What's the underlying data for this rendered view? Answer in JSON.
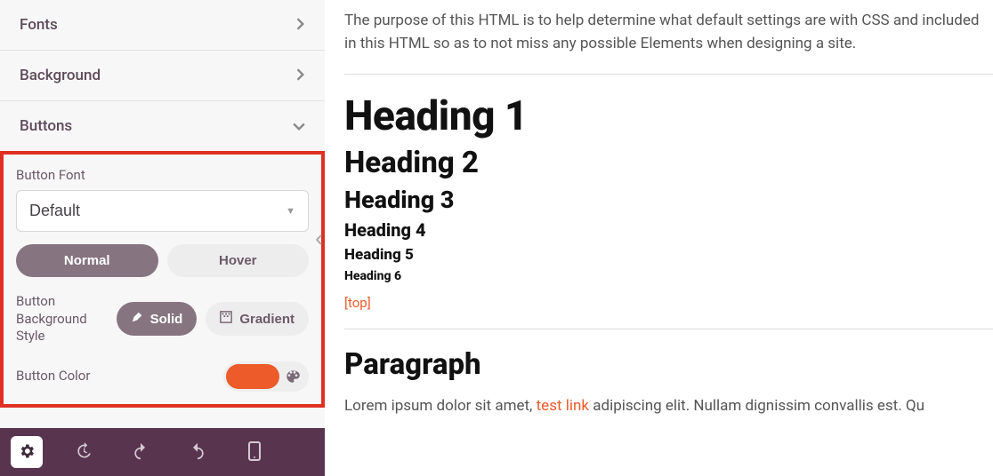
{
  "sidebar": {
    "sections": {
      "fonts": "Fonts",
      "background": "Background",
      "buttons": "Buttons"
    },
    "buttonFont": {
      "label": "Button Font",
      "value": "Default"
    },
    "stateTabs": {
      "normal": "Normal",
      "hover": "Hover"
    },
    "bgStyle": {
      "label": "Button Background Style",
      "solid": "Solid",
      "gradient": "Gradient"
    },
    "buttonColor": {
      "label": "Button Color",
      "swatch": "#ec5b29"
    }
  },
  "preview": {
    "intro": "The purpose of this HTML is to help determine what default settings are with CSS and included in this HTML so as to not miss any possible Elements when designing a site.",
    "h1": "Heading 1",
    "h2": "Heading 2",
    "h3": "Heading 3",
    "h4": "Heading 4",
    "h5": "Heading 5",
    "h6": "Heading 6",
    "top": "[top]",
    "paraHeading": "Paragraph",
    "paraPrefix": "Lorem ipsum dolor sit amet, ",
    "paraLink": "test link",
    "paraSuffix": " adipiscing elit. Nullam dignissim convallis est. Qu"
  }
}
